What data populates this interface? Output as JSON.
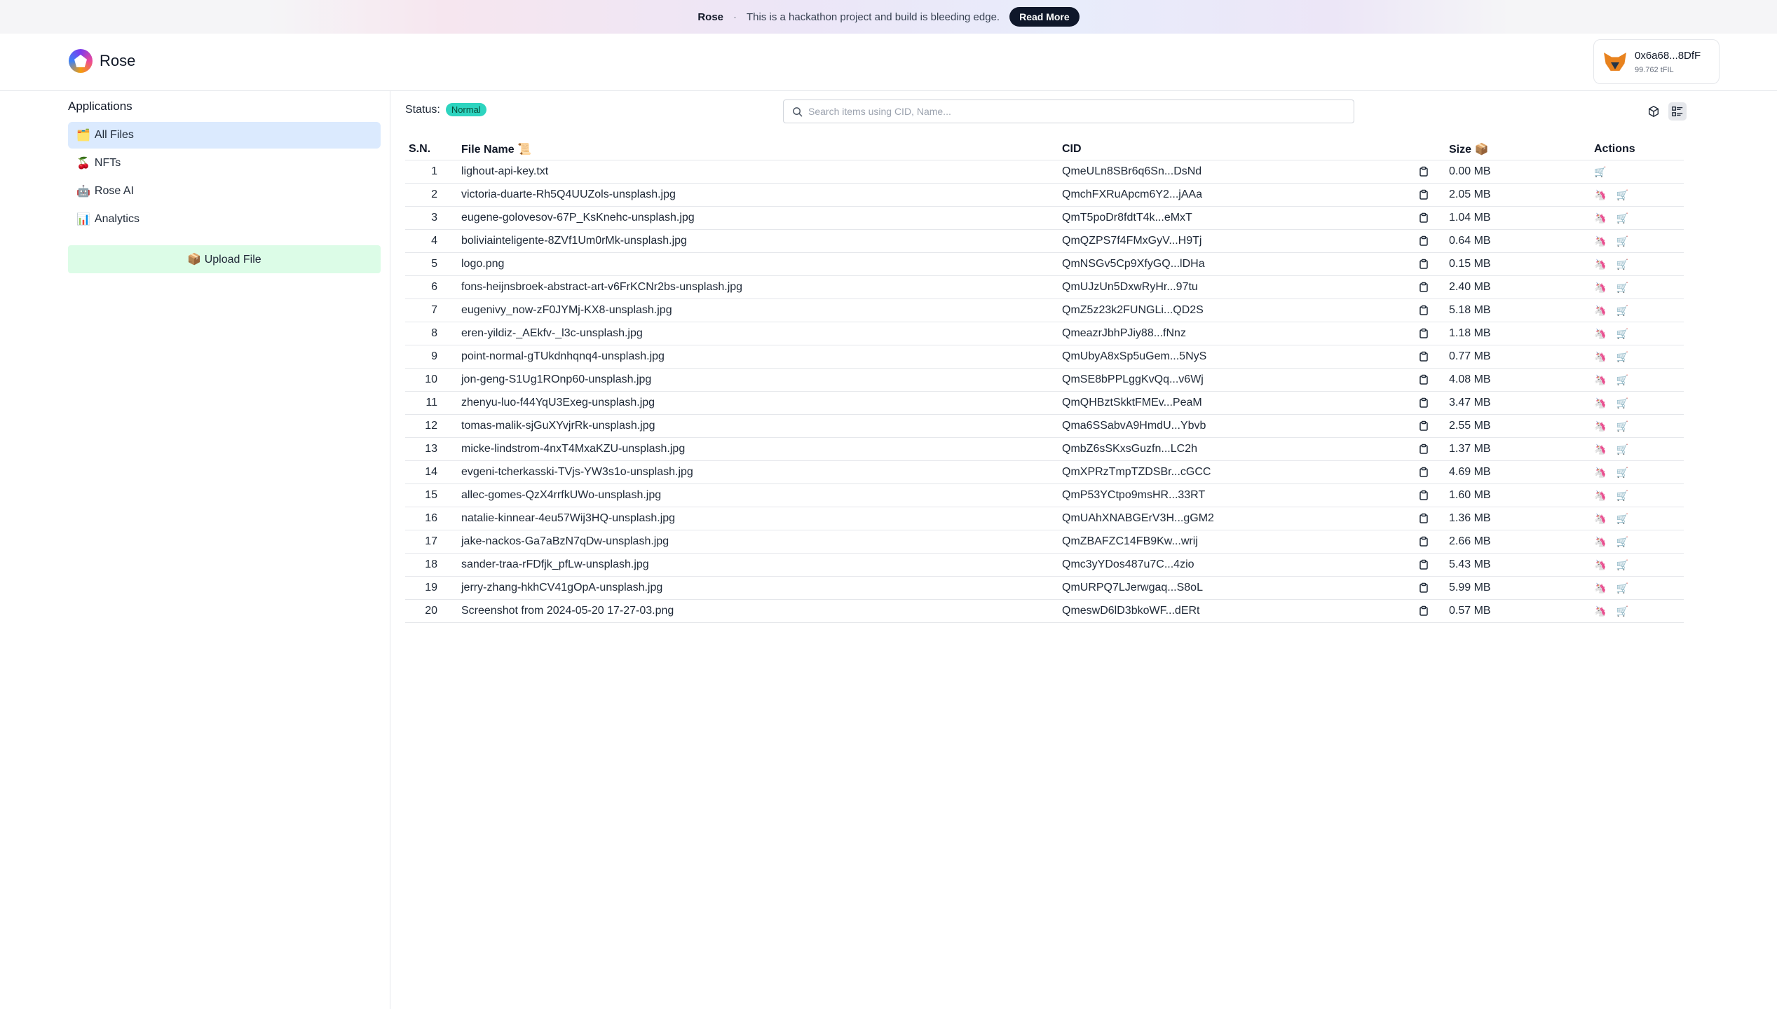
{
  "banner": {
    "brand": "Rose",
    "separator": "·",
    "message": "This is a hackathon project and build is bleeding edge.",
    "button": "Read More"
  },
  "header": {
    "logo_text": "Rose",
    "wallet": {
      "address": "0x6a68...8DfF",
      "balance": "99.762 tFIL"
    }
  },
  "sidebar": {
    "title": "Applications",
    "items": [
      {
        "emoji": "🗂️",
        "label": "All Files",
        "active": true
      },
      {
        "emoji": "🍒",
        "label": "NFTs",
        "active": false
      },
      {
        "emoji": "🤖",
        "label": "Rose AI",
        "active": false
      },
      {
        "emoji": "📊",
        "label": "Analytics",
        "active": false
      }
    ],
    "upload": "📦 Upload File"
  },
  "main": {
    "status_label": "Status:",
    "status_value": "Normal",
    "search_placeholder": "Search items using CID, Name...",
    "columns": {
      "sn": "S.N.",
      "name": "File Name 📜",
      "cid": "CID",
      "size": "Size 📦",
      "actions": "Actions"
    },
    "action_icons": {
      "mint": "🦄",
      "cart": "🛒"
    },
    "rows": [
      {
        "sn": "1",
        "name": "lighout-api-key.txt",
        "cid": "QmeULn8SBr6q6Sn...DsNd",
        "size": "0.00 MB",
        "mint": false
      },
      {
        "sn": "2",
        "name": "victoria-duarte-Rh5Q4UUZols-unsplash.jpg",
        "cid": "QmchFXRuApcm6Y2...jAAa",
        "size": "2.05 MB",
        "mint": true
      },
      {
        "sn": "3",
        "name": "eugene-golovesov-67P_KsKnehc-unsplash.jpg",
        "cid": "QmT5poDr8fdtT4k...eMxT",
        "size": "1.04 MB",
        "mint": true
      },
      {
        "sn": "4",
        "name": "boliviainteligente-8ZVf1Um0rMk-unsplash.jpg",
        "cid": "QmQZPS7f4FMxGyV...H9Tj",
        "size": "0.64 MB",
        "mint": true
      },
      {
        "sn": "5",
        "name": "logo.png",
        "cid": "QmNSGv5Cp9XfyGQ...lDHa",
        "size": "0.15 MB",
        "mint": true
      },
      {
        "sn": "6",
        "name": "fons-heijnsbroek-abstract-art-v6FrKCNr2bs-unsplash.jpg",
        "cid": "QmUJzUn5DxwRyHr...97tu",
        "size": "2.40 MB",
        "mint": true
      },
      {
        "sn": "7",
        "name": "eugenivy_now-zF0JYMj-KX8-unsplash.jpg",
        "cid": "QmZ5z23k2FUNGLi...QD2S",
        "size": "5.18 MB",
        "mint": true
      },
      {
        "sn": "8",
        "name": "eren-yildiz-_AEkfv-_l3c-unsplash.jpg",
        "cid": "QmeazrJbhPJiy88...fNnz",
        "size": "1.18 MB",
        "mint": true
      },
      {
        "sn": "9",
        "name": "point-normal-gTUkdnhqnq4-unsplash.jpg",
        "cid": "QmUbyA8xSp5uGem...5NyS",
        "size": "0.77 MB",
        "mint": true
      },
      {
        "sn": "10",
        "name": "jon-geng-S1Ug1ROnp60-unsplash.jpg",
        "cid": "QmSE8bPPLggKvQq...v6Wj",
        "size": "4.08 MB",
        "mint": true
      },
      {
        "sn": "11",
        "name": "zhenyu-luo-f44YqU3Exeg-unsplash.jpg",
        "cid": "QmQHBztSkktFMEv...PeaM",
        "size": "3.47 MB",
        "mint": true
      },
      {
        "sn": "12",
        "name": "tomas-malik-sjGuXYvjrRk-unsplash.jpg",
        "cid": "Qma6SSabvA9HmdU...Ybvb",
        "size": "2.55 MB",
        "mint": true
      },
      {
        "sn": "13",
        "name": "micke-lindstrom-4nxT4MxaKZU-unsplash.jpg",
        "cid": "QmbZ6sSKxsGuzfn...LC2h",
        "size": "1.37 MB",
        "mint": true
      },
      {
        "sn": "14",
        "name": "evgeni-tcherkasski-TVjs-YW3s1o-unsplash.jpg",
        "cid": "QmXPRzTmpTZDSBr...cGCC",
        "size": "4.69 MB",
        "mint": true
      },
      {
        "sn": "15",
        "name": "allec-gomes-QzX4rrfkUWo-unsplash.jpg",
        "cid": "QmP53YCtpo9msHR...33RT",
        "size": "1.60 MB",
        "mint": true
      },
      {
        "sn": "16",
        "name": "natalie-kinnear-4eu57Wij3HQ-unsplash.jpg",
        "cid": "QmUAhXNABGErV3H...gGM2",
        "size": "1.36 MB",
        "mint": true
      },
      {
        "sn": "17",
        "name": "jake-nackos-Ga7aBzN7qDw-unsplash.jpg",
        "cid": "QmZBAFZC14FB9Kw...wrij",
        "size": "2.66 MB",
        "mint": true
      },
      {
        "sn": "18",
        "name": "sander-traa-rFDfjk_pfLw-unsplash.jpg",
        "cid": "Qmc3yYDos487u7C...4zio",
        "size": "5.43 MB",
        "mint": true
      },
      {
        "sn": "19",
        "name": "jerry-zhang-hkhCV41gOpA-unsplash.jpg",
        "cid": "QmURPQ7LJerwgaq...S8oL",
        "size": "5.99 MB",
        "mint": true
      },
      {
        "sn": "20",
        "name": "Screenshot from 2024-05-20 17-27-03.png",
        "cid": "QmeswD6lD3bkoWF...dERt",
        "size": "0.57 MB",
        "mint": true
      }
    ]
  },
  "colors": {
    "active_nav": "#dbeafe",
    "upload_bg": "#dcfce7",
    "status_badge": "#2dd4bf",
    "read_more_bg": "#0f172a"
  }
}
